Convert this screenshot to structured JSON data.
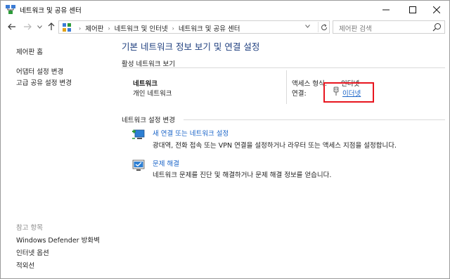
{
  "window": {
    "title": "네트워크 및 공유 센터"
  },
  "address": {
    "breadcrumbs": [
      "제어판",
      "네트워크 및 인터넷",
      "네트워크 및 공유 센터"
    ],
    "search_placeholder": "제어판 검색"
  },
  "sidebar": {
    "home": "제어판 홈",
    "links": [
      "어댑터 설정 변경",
      "고급 공유 설정 변경"
    ],
    "see_also_heading": "참고 항목",
    "see_also": [
      "Windows Defender 방화벽",
      "인터넷 옵션",
      "적외선"
    ]
  },
  "main": {
    "title": "기본 네트워크 정보 보기 및 연결 설정",
    "active_networks_heading": "활성 네트워크 보기",
    "network": {
      "name": "네트워크",
      "type": "개인 네트워크",
      "access_type_label": "액세스 형식:",
      "access_type_value": "인터넷",
      "connections_label": "연결:",
      "connection_value": "이더넷"
    },
    "change_settings_heading": "네트워크 설정 변경",
    "tasks": [
      {
        "title": "새 연결 또는 네트워크 설정",
        "desc": "광대역, 전화 접속 또는 VPN 연결을 설정하거나 라우터 또는 액세스 지점을 설정합니다."
      },
      {
        "title": "문제 해결",
        "desc": "네트워크 문제를 진단 및 해결하거나 문제 해결 정보를 얻습니다."
      }
    ]
  },
  "colors": {
    "link": "#1a64c8",
    "title": "#1f3f7f",
    "highlight": "#e8151f"
  }
}
